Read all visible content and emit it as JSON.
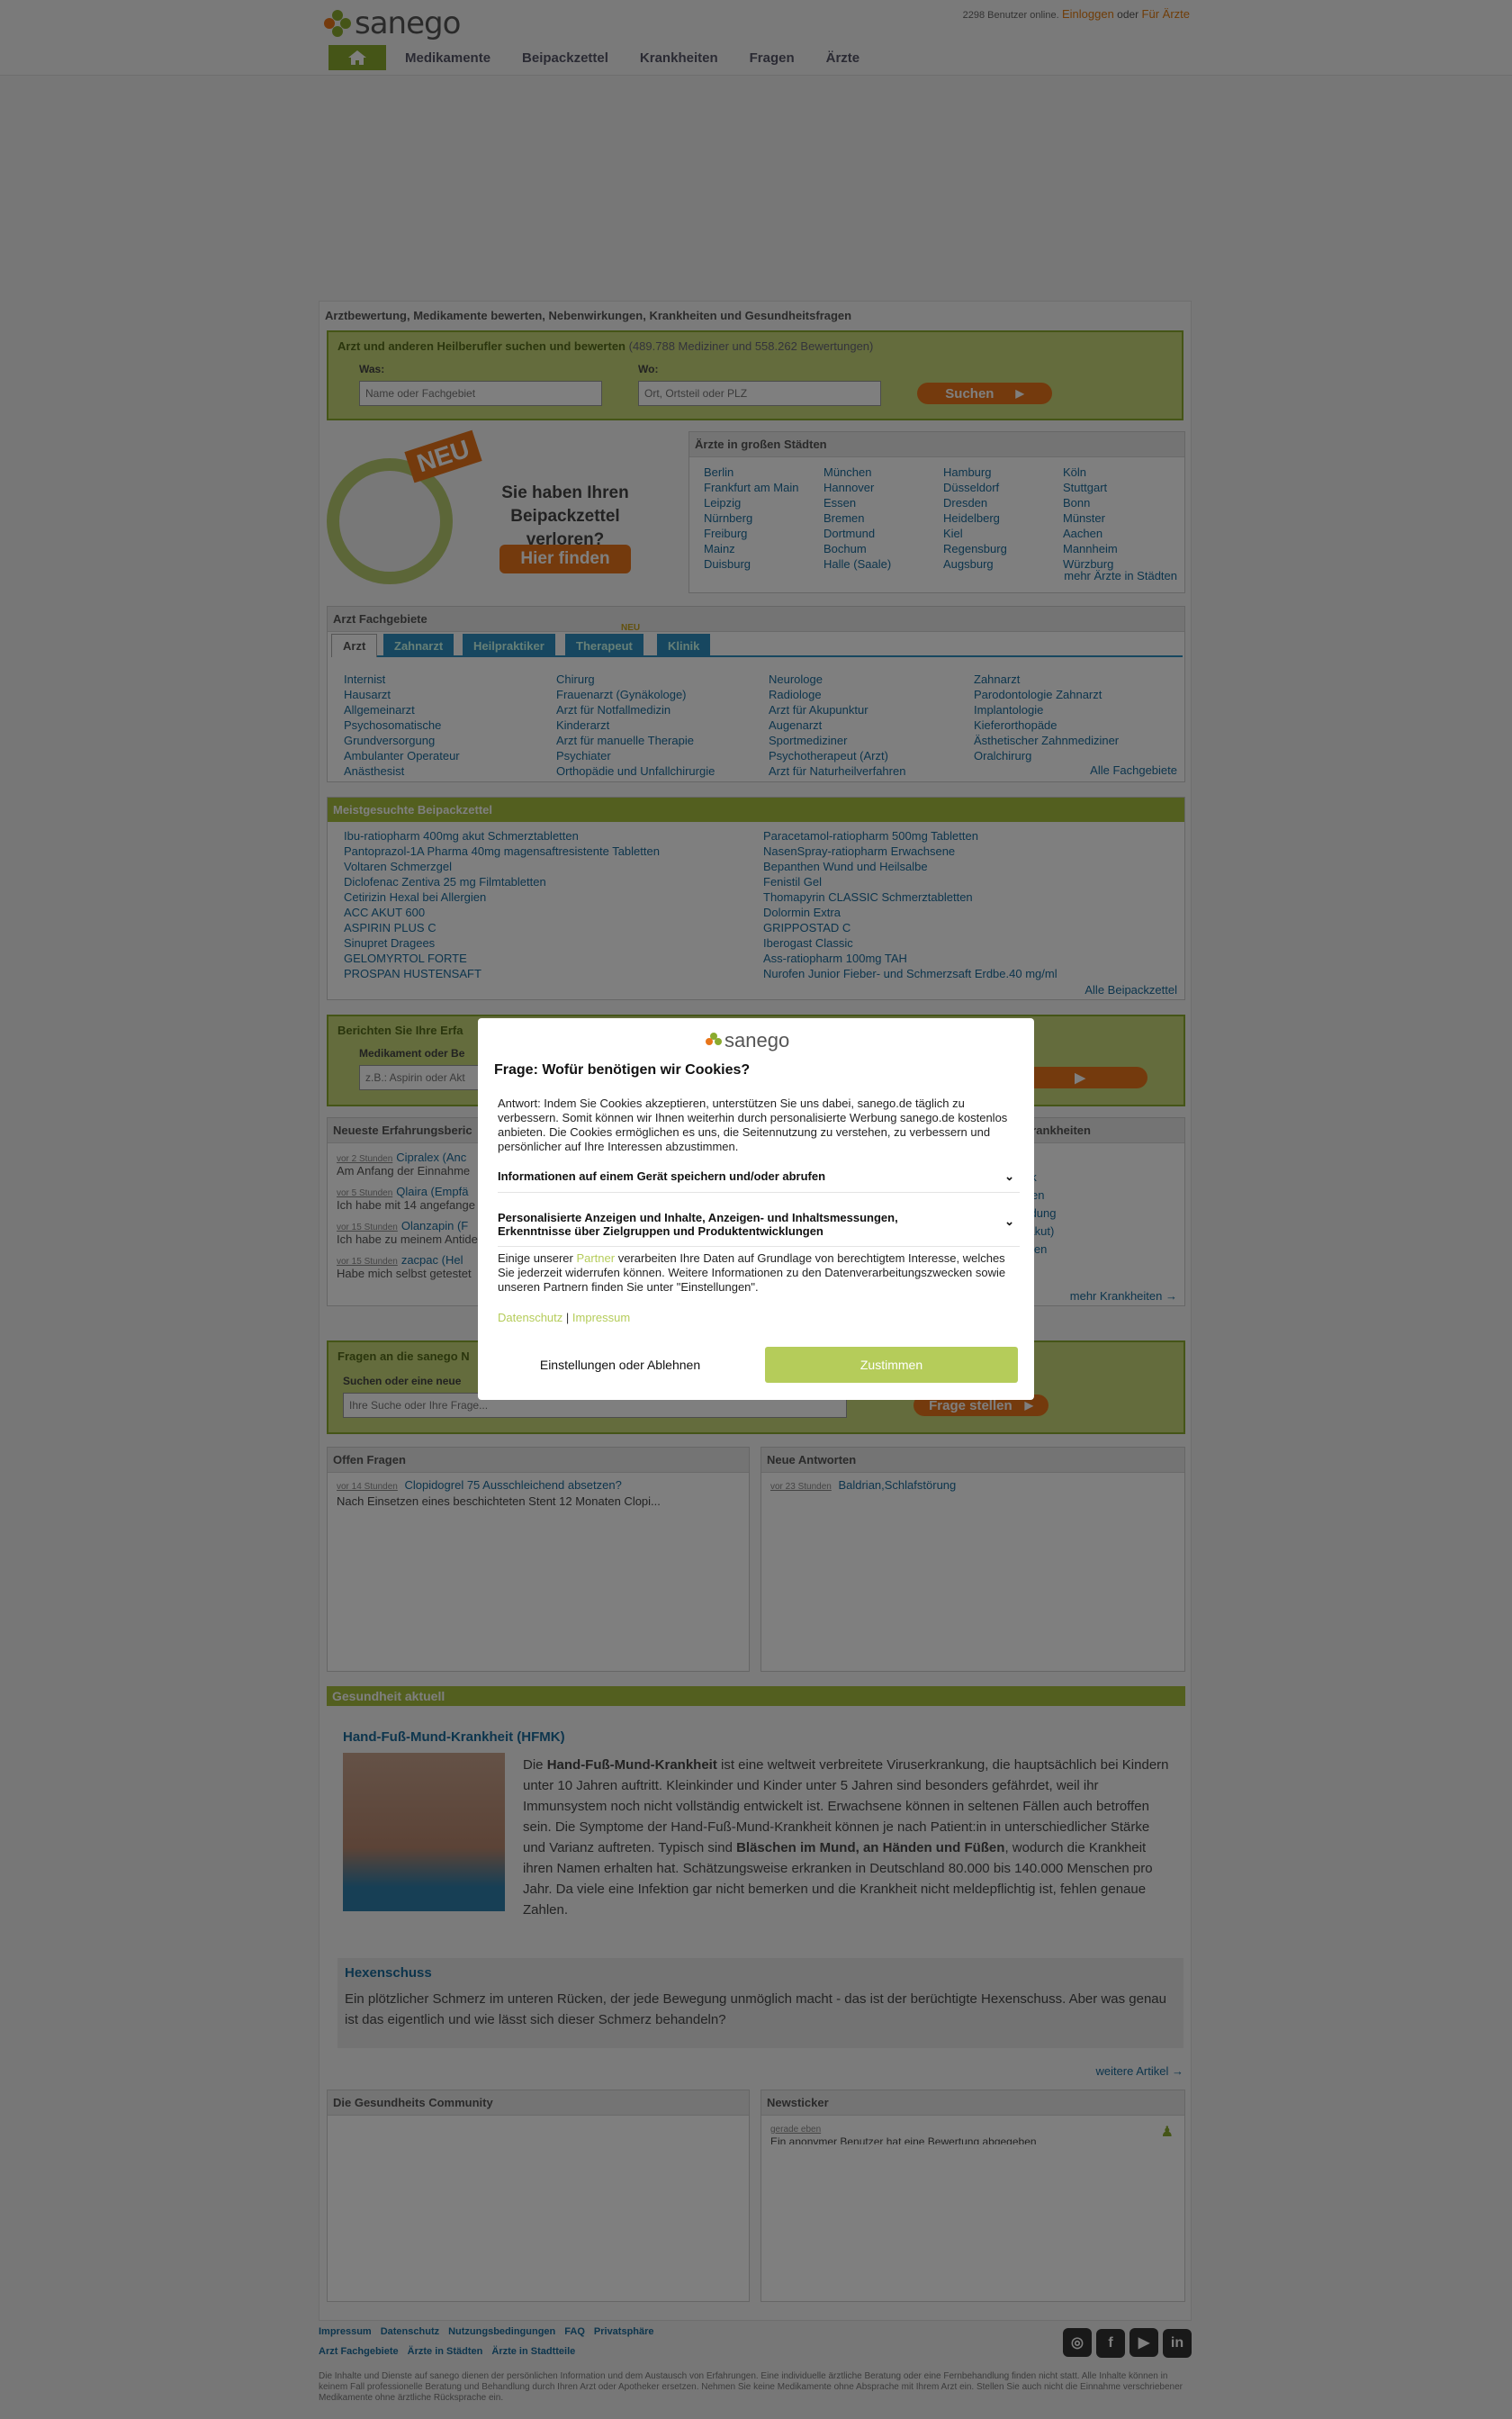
{
  "header": {
    "brand": "sanego",
    "users_online": "2298 Benutzer online.",
    "login": "Einloggen",
    "or": "oder",
    "for_doctors": "Für Ärzte",
    "nav": [
      "Medikamente",
      "Beipackzettel",
      "Krankheiten",
      "Fragen",
      "Ärzte"
    ]
  },
  "intro": {
    "title": "Arztbewertung, Medikamente bewerten, Nebenwirkungen, Krankheiten und Gesundheitsfragen"
  },
  "search": {
    "title": "Arzt und anderen Heilberufler suchen und bewerten",
    "count": "(489.788 Mediziner und 558.262 Bewertungen)",
    "was_label": "Was:",
    "was_placeholder": "Name oder Fachgebiet",
    "wo_label": "Wo:",
    "wo_placeholder": "Ort, Ortsteil oder PLZ",
    "button": "Suchen"
  },
  "promo": {
    "badge": "NEU",
    "text": "Sie haben Ihren Beipackzettel verloren?",
    "button": "Hier finden"
  },
  "cities": {
    "title": "Ärzte in großen Städten",
    "items": [
      "Berlin",
      "München",
      "Hamburg",
      "Köln",
      "Frankfurt am Main",
      "Hannover",
      "Düsseldorf",
      "Stuttgart",
      "Leipzig",
      "Essen",
      "Dresden",
      "Bonn",
      "Nürnberg",
      "Bremen",
      "Heidelberg",
      "Münster",
      "Freiburg",
      "Dortmund",
      "Kiel",
      "Aachen",
      "Mainz",
      "Bochum",
      "Regensburg",
      "Mannheim",
      "Duisburg",
      "Halle (Saale)",
      "Augsburg",
      "Würzburg"
    ],
    "more": "mehr Ärzte in Städten"
  },
  "fach": {
    "title": "Arzt Fachgebiete",
    "tabs": [
      "Arzt",
      "Zahnarzt",
      "Heilpraktiker",
      "Therapeut",
      "Klinik"
    ],
    "new_tag": "NEU",
    "cols": [
      [
        "Internist",
        "Hausarzt",
        "Allgemeinarzt",
        "Psychosomatische",
        "Grundversorgung",
        "Ambulanter Operateur",
        "Anästhesist"
      ],
      [
        "Chirurg",
        "Frauenarzt (Gynäkologe)",
        "Arzt für Notfallmedizin",
        "Kinderarzt",
        "Arzt für manuelle Therapie",
        "Psychiater",
        "Orthopädie und Unfallchirurgie"
      ],
      [
        "Neurologe",
        "Radiologe",
        "Arzt für Akupunktur",
        "Augenarzt",
        "Sportmediziner",
        "Psychotherapeut (Arzt)",
        "Arzt für Naturheilverfahren"
      ],
      [
        "Zahnarzt",
        "Parodontologie Zahnarzt",
        "Implantologie",
        "Kieferorthopäde",
        "Ästhetischer Zahnmediziner",
        "Oralchirurg"
      ]
    ],
    "all": "Alle Fachgebiete"
  },
  "beipack": {
    "title": "Meistgesuchte Beipackzettel",
    "left": [
      "Ibu-ratiopharm 400mg akut Schmerztabletten",
      "Pantoprazol-1A Pharma 40mg magensaftresistente Tabletten",
      "Voltaren Schmerzgel",
      "Diclofenac Zentiva 25 mg Filmtabletten",
      "Cetirizin Hexal bei Allergien",
      "ACC AKUT 600",
      "ASPIRIN PLUS C",
      "Sinupret Dragees",
      "GELOMYRTOL FORTE",
      "PROSPAN HUSTENSAFT"
    ],
    "right": [
      "Paracetamol-ratiopharm 500mg Tabletten",
      "NasenSpray-ratiopharm Erwachsene",
      "Bepanthen Wund und Heilsalbe",
      "Fenistil Gel",
      "Thomapyrin CLASSIC Schmerztabletten",
      "Dolormin Extra",
      "GRIPPOSTAD C",
      "Iberogast Classic",
      "Ass-ratiopharm 100mg TAH",
      "Nurofen Junior Fieber- und Schmerzsaft Erdbe.40 mg/ml"
    ],
    "all": "Alle Beipackzettel"
  },
  "report": {
    "title": "Berichten Sie Ihre Erfa",
    "label": "Medikament oder Be",
    "placeholder": "z.B.: Aspirin oder Akt"
  },
  "reports": {
    "title": "Neueste Erfahrungsberic",
    "items": [
      {
        "time": "vor 2 Stunden",
        "name": "Cipralex (Anc",
        "text": "Am Anfang der Einnahme"
      },
      {
        "time": "vor 5 Stunden",
        "name": "Qlaira (Empfä",
        "text": "Ich habe mit 14 angefange"
      },
      {
        "time": "vor 15 Stunden",
        "name": "Olanzapin (F",
        "text": "Ich habe zu meinem Antide"
      },
      {
        "time": "vor 15 Stunden",
        "name": "zacpac (Hel",
        "text": "Habe mich selbst getestet"
      }
    ]
  },
  "krank": {
    "title": "e Krankheiten",
    "items": [
      "on",
      "druck",
      "rungen",
      "tzündung",
      "en (akut)",
      "merzen"
    ],
    "more": "mehr Krankheiten →"
  },
  "fragen": {
    "title": "Fragen an die sanego N",
    "label": "Suchen oder eine neue",
    "placeholder": "Ihre Suche oder Ihre Frage...",
    "button": "Frage stellen"
  },
  "open": {
    "title": "Offen Fragen",
    "time": "vor 14 Stunden",
    "q": "Clopidogrel 75 Ausschleichend absetzen?",
    "text": "Nach Einsetzen eines beschichteten Stent 12 Monaten Clopi..."
  },
  "answers": {
    "title": "Neue Antworten",
    "time": "vor 23 Stunden",
    "q": "Baldrian,Schlafstörung"
  },
  "health": {
    "title": "Gesundheit aktuell",
    "article1": {
      "title": "Hand-Fuß-Mund-Krankheit (HFMK)",
      "p1": "Die ",
      "b1": "Hand-Fuß-Mund-Krankheit",
      "p2": " ist eine weltweit verbreitete Viruserkrankung, die hauptsächlich bei Kindern unter 10 Jahren auftritt. Kleinkinder und Kinder unter 5 Jahren sind besonders gefährdet, weil ihr Immunsystem noch nicht vollständig entwickelt ist. Erwachsene können in seltenen Fällen auch betroffen sein. Die Symptome der Hand-Fuß-Mund-Krankheit können je nach Patient:in in unterschiedlicher Stärke und Varianz auftreten. Typisch sind ",
      "b2": "Bläschen im Mund, an Händen und Füßen",
      "p3": ", wodurch die Krankheit ihren Namen erhalten hat. Schätzungsweise erkranken in Deutschland 80.000 bis 140.000 Menschen pro Jahr. Da viele eine Infektion gar nicht bemerken und die Krankheit nicht meldepflichtig ist, fehlen genaue Zahlen."
    },
    "article2": {
      "title": "Hexenschuss",
      "text": "Ein plötzlicher Schmerz im unteren Rücken, der jede Bewegung unmöglich macht - das ist der berüchtigte Hexenschuss. Aber was genau ist das eigentlich und wie lässt sich dieser Schmerz behandeln?"
    },
    "more": "weitere Artikel →"
  },
  "community": {
    "title": "Die Gesundheits Community"
  },
  "ticker": {
    "title": "Newsticker",
    "time": "gerade eben",
    "text": "Ein anonymer Benutzer hat eine Bewertung abgegeben"
  },
  "footer": {
    "links1": [
      "Impressum",
      "Datenschutz",
      "Nutzungsbedingungen",
      "FAQ",
      "Privatsphäre"
    ],
    "links2": [
      "Arzt Fachgebiete",
      "Ärzte in Städten",
      "Ärzte in Stadtteile"
    ],
    "disclaimer": "Die Inhalte und Dienste auf sanego dienen der persönlichen Information und dem Austausch von Erfahrungen. Eine individuelle ärztliche Beratung oder eine Fernbehandlung finden nicht statt. Alle Inhalte können in keinem Fall professionelle Beratung und Behandlung durch Ihren Arzt oder Apotheker ersetzen. Nehmen Sie keine Medikamente ohne Absprache mit Ihrem Arzt ein. Stellen Sie auch nicht die Einnahme verschriebener Medikamente ohne ärztliche Rücksprache ein."
  },
  "cookie": {
    "brand": "sanego",
    "title": "Frage: Wofür benötigen wir Cookies?",
    "text": "Antwort: Indem Sie Cookies akzeptieren, unterstützen Sie uns dabei, sanego.de täglich zu verbessern. Somit können wir Ihnen weiterhin durch personalisierte Werbung sanego.de kostenlos anbieten. Die Cookies ermöglichen es uns, die Seitennutzung zu verstehen, zu verbessern und persönlicher auf Ihre Interessen abzustimmen.",
    "acc1": "Informationen auf einem Gerät speichern und/oder abrufen",
    "acc2": "Personalisierte Anzeigen und Inhalte, Anzeigen- und Inhaltsmessungen, Erkenntnisse über Zielgruppen und Produktentwicklungen",
    "partner_pre": "Einige unserer ",
    "partner": "Partner",
    "partner_post": " verarbeiten Ihre Daten auf Grundlage von berechtigtem Interesse, welches Sie jederzeit widerrufen können. Weitere Informationen zu den Datenverarbeitungszwecken sowie unseren Partnern finden Sie unter \"Einstellungen\".",
    "privacy": "Datenschutz",
    "sep": "|",
    "imprint": "Impressum",
    "decline": "Einstellungen oder Ablehnen",
    "accept": "Zustimmen"
  },
  "colors": {
    "green": "#8aab2e",
    "orange": "#e8751a",
    "link": "#1a6a9a",
    "accept": "#b5cc5a"
  }
}
